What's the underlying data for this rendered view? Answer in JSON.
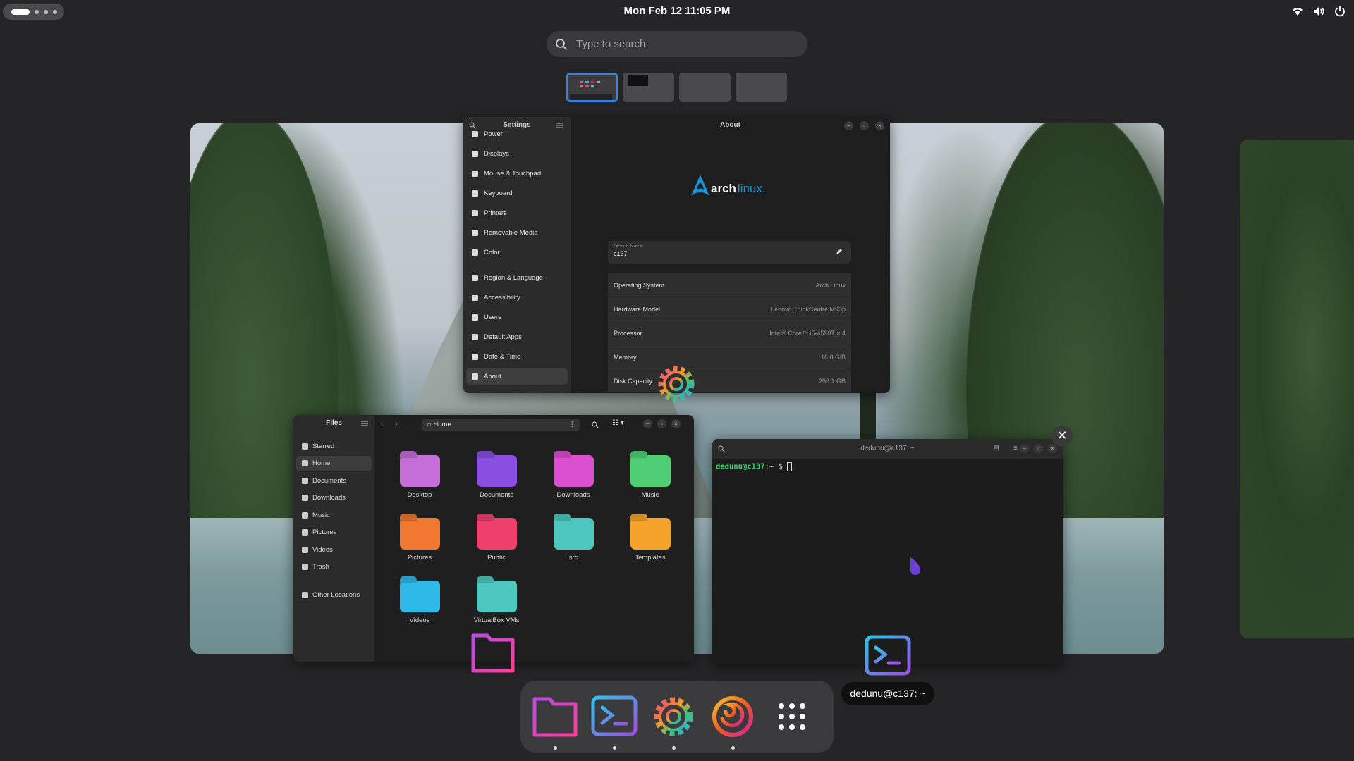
{
  "topbar": {
    "clock": "Mon Feb 12  11:05 PM",
    "tray_icons": [
      "wifi-icon",
      "volume-icon",
      "power-icon"
    ]
  },
  "search": {
    "placeholder": "Type to search"
  },
  "workspaces": {
    "count": 4,
    "active": 1
  },
  "settings_window": {
    "title": "Settings",
    "panel_title": "About",
    "sidebar": [
      "Power",
      "Displays",
      "Mouse & Touchpad",
      "Keyboard",
      "Printers",
      "Removable Media",
      "Color",
      "Region & Language",
      "Accessibility",
      "Users",
      "Default Apps",
      "Date & Time",
      "About"
    ],
    "selected": "About",
    "logo_text_bold": "arch",
    "logo_text_light": "linux.",
    "device_name_label": "Device Name",
    "device_name": "c137",
    "info_rows": [
      {
        "label": "Operating System",
        "value": "Arch Linux"
      },
      {
        "label": "Hardware Model",
        "value": "Lenovo ThinkCentre M93p"
      },
      {
        "label": "Processor",
        "value": "Intel® Core™ i5-4590T × 4"
      },
      {
        "label": "Memory",
        "value": "16.0 GiB"
      },
      {
        "label": "Disk Capacity",
        "value": "256.1 GB"
      }
    ]
  },
  "files_window": {
    "title": "Files",
    "path": "Home",
    "sidebar": [
      "Starred",
      "Home",
      "Documents",
      "Downloads",
      "Music",
      "Pictures",
      "Videos",
      "Trash",
      "Other Locations"
    ],
    "selected": "Home",
    "folders": [
      {
        "name": "Desktop",
        "color": "#c66ed8"
      },
      {
        "name": "Documents",
        "color": "#8a4fe0"
      },
      {
        "name": "Downloads",
        "color": "#d94fd0"
      },
      {
        "name": "Music",
        "color": "#4fcf74"
      },
      {
        "name": "Pictures",
        "color": "#f2772f"
      },
      {
        "name": "Public",
        "color": "#ee3f6d"
      },
      {
        "name": "src",
        "color": "#4cc8c0"
      },
      {
        "name": "Templates",
        "color": "#f5a32b"
      },
      {
        "name": "Videos",
        "color": "#2fb9e8"
      },
      {
        "name": "VirtualBox VMs",
        "color": "#4cc8c0"
      }
    ]
  },
  "terminal_window": {
    "title": "dedunu@c137: ~",
    "prompt_user": "dedunu@c137",
    "prompt_rest": ":~ $ "
  },
  "tooltip": "dedunu@c137: ~",
  "dock": {
    "apps": [
      "files-app",
      "terminal-app",
      "settings-app",
      "firefox-app",
      "app-grid"
    ]
  }
}
